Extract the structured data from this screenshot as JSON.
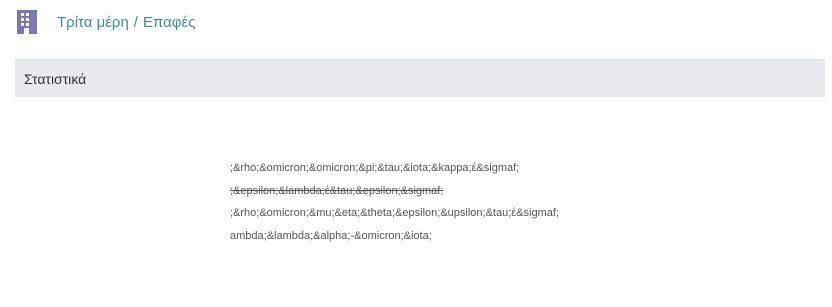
{
  "header": {
    "icon": "building-icon",
    "icon_color": "#7b78b4",
    "breadcrumb": {
      "parent": "Τρίτα μέρη",
      "separator": "/",
      "current": "Επαφές"
    }
  },
  "panel": {
    "title": "Στατιστικά"
  },
  "stats_lines": [
    ";&rho;&omicron;&omicron;&pi;&tau;&iota;&kappa;έ&sigmaf;",
    ";&epsilon;&lambda;έ&tau;&epsilon;&sigmaf;",
    ";&rho;&omicron;&mu;&eta;&theta;&epsilon;&upsilon;&tau;έ&sigmaf;",
    "ambda;&lambda;&alpha;-&omicron;&iota;"
  ]
}
